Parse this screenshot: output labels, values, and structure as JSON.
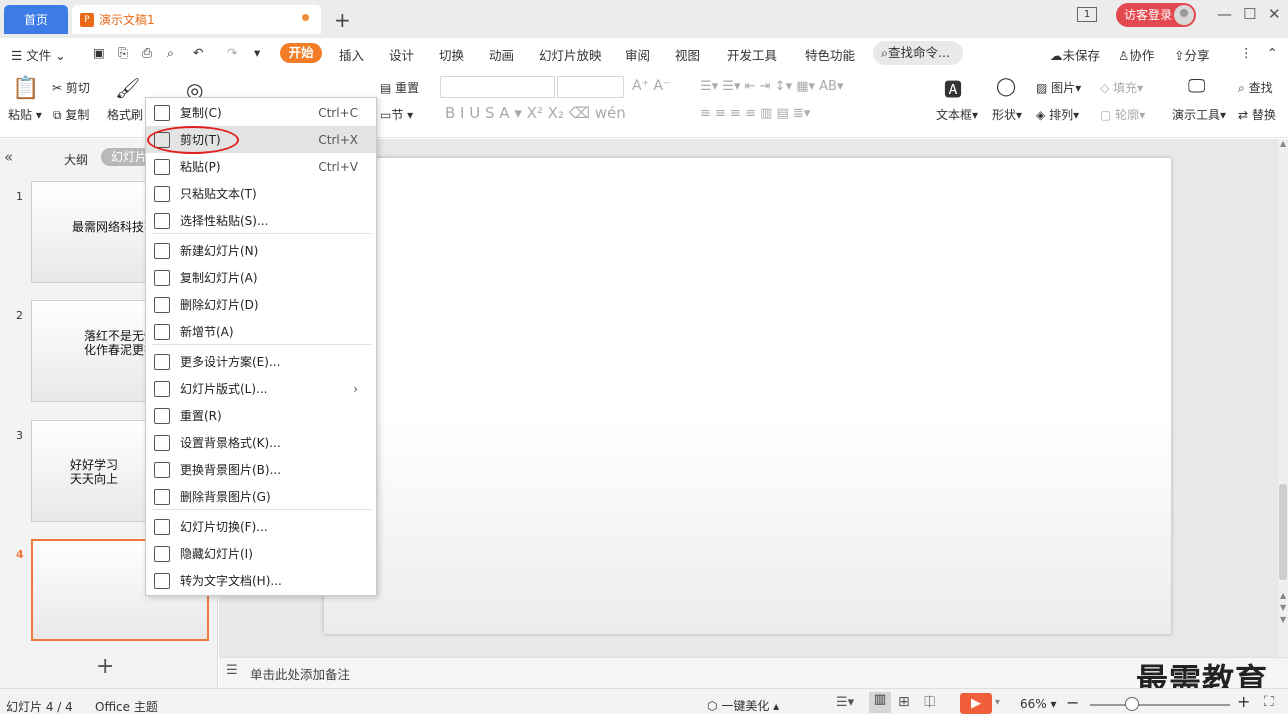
{
  "tabs": {
    "home": "首页",
    "doc": "演示文稿1",
    "new": "+"
  },
  "window": {
    "login": "访客登录",
    "page_indicator": "1"
  },
  "menu": {
    "file": "文件",
    "items": [
      "开始",
      "插入",
      "设计",
      "切换",
      "动画",
      "幻灯片放映",
      "审阅",
      "视图",
      "开发工具",
      "特色功能"
    ],
    "search": "查找命令...",
    "unsaved": "未保存",
    "collab": "协作",
    "share": "分享"
  },
  "ribbon": {
    "paste": "粘贴",
    "cut": "剪切",
    "copy": "复制",
    "format_painter": "格式刷",
    "reset": "重置",
    "section": "节",
    "textbox": "文本框",
    "shape": "形状",
    "picture": "图片",
    "arrange": "排列",
    "fill": "填充",
    "outline": "轮廓",
    "present_tools": "演示工具",
    "find": "查找",
    "replace": "替换"
  },
  "panel": {
    "outline_tab": "大纲",
    "slides_tab": "幻灯片",
    "add": "+"
  },
  "slides": [
    {
      "num": "1",
      "text": "最需网络科技有限"
    },
    {
      "num": "2",
      "text": "落红不是无情\n化作春泥更护"
    },
    {
      "num": "3",
      "text": "好好学习\n天天向上"
    },
    {
      "num": "4",
      "text": ""
    }
  ],
  "notes": {
    "placeholder": "单击此处添加备注"
  },
  "status": {
    "slide": "幻灯片 4 / 4",
    "theme": "Office 主题",
    "beautify": "一键美化",
    "zoom": "66%"
  },
  "watermark": "最需教育",
  "context_menu": [
    {
      "label": "复制(C)",
      "shortcut": "Ctrl+C",
      "icon": "copy-icon"
    },
    {
      "label": "剪切(T)",
      "shortcut": "Ctrl+X",
      "icon": "scissors-icon",
      "highlighted": true
    },
    {
      "label": "粘贴(P)",
      "shortcut": "Ctrl+V",
      "icon": "paste-icon"
    },
    {
      "label": "只粘贴文本(T)",
      "shortcut": "",
      "icon": "paste-text-icon"
    },
    {
      "label": "选择性粘贴(S)...",
      "shortcut": "",
      "icon": "paste-special-icon"
    },
    {
      "label": "新建幻灯片(N)",
      "shortcut": "",
      "icon": "new-slide-icon"
    },
    {
      "label": "复制幻灯片(A)",
      "shortcut": "",
      "icon": "duplicate-slide-icon"
    },
    {
      "label": "删除幻灯片(D)",
      "shortcut": "",
      "icon": "delete-slide-icon"
    },
    {
      "label": "新增节(A)",
      "shortcut": "",
      "icon": "new-section-icon"
    },
    {
      "label": "更多设计方案(E)...",
      "shortcut": "",
      "icon": "design-icon"
    },
    {
      "label": "幻灯片版式(L)...",
      "shortcut": "›",
      "icon": "layout-icon"
    },
    {
      "label": "重置(R)",
      "shortcut": "",
      "icon": "reset-icon"
    },
    {
      "label": "设置背景格式(K)...",
      "shortcut": "",
      "icon": "background-format-icon"
    },
    {
      "label": "更换背景图片(B)...",
      "shortcut": "",
      "icon": "change-background-icon"
    },
    {
      "label": "删除背景图片(G)",
      "shortcut": "",
      "icon": "delete-background-icon"
    },
    {
      "label": "幻灯片切换(F)...",
      "shortcut": "",
      "icon": "transition-icon"
    },
    {
      "label": "隐藏幻灯片(I)",
      "shortcut": "",
      "icon": "hide-slide-icon"
    },
    {
      "label": "转为文字文档(H)...",
      "shortcut": "",
      "icon": "to-document-icon"
    }
  ]
}
